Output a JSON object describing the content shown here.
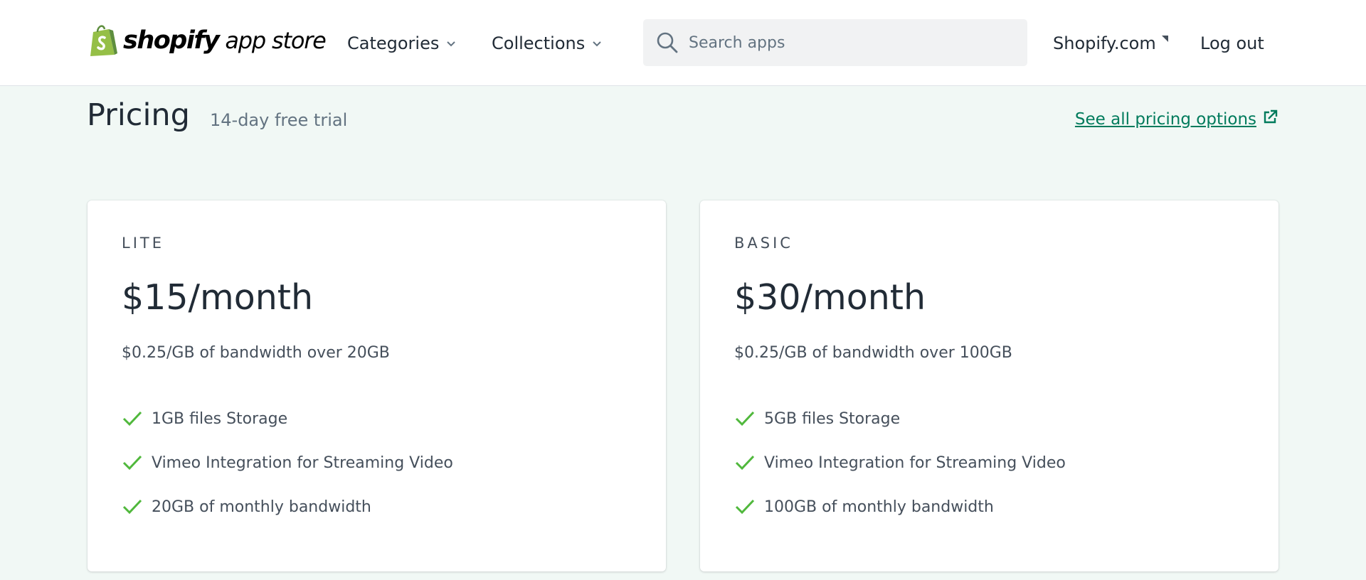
{
  "header": {
    "logo_word": "shopify",
    "logo_sub": "app store",
    "nav": [
      {
        "label": "Categories"
      },
      {
        "label": "Collections"
      }
    ],
    "search": {
      "placeholder": "Search apps",
      "value": ""
    },
    "shopify_link": "Shopify.com",
    "logout": "Log out"
  },
  "pricing": {
    "title": "Pricing",
    "subtitle": "14-day free trial",
    "see_all": "See all pricing options"
  },
  "plans": [
    {
      "name": "LITE",
      "price": "$15/month",
      "extra": "$0.25/GB of bandwidth over 20GB",
      "features": [
        "1GB files Storage",
        "Vimeo Integration for Streaming Video",
        "20GB of monthly bandwidth"
      ]
    },
    {
      "name": "BASIC",
      "price": "$30/month",
      "extra": "$0.25/GB of bandwidth over 100GB",
      "features": [
        "5GB files Storage",
        "Vimeo Integration for Streaming Video",
        "100GB of monthly bandwidth"
      ]
    }
  ],
  "colors": {
    "page_background": "#f1f8f5",
    "brand_green": "#95bf47",
    "link_green": "#007b5c",
    "check_green": "#50b83c"
  },
  "icons": {
    "logo": "shopify-bag-icon",
    "chevron": "chevron-down-icon",
    "search": "search-icon",
    "external": "external-link-icon",
    "check": "checkmark-icon"
  }
}
